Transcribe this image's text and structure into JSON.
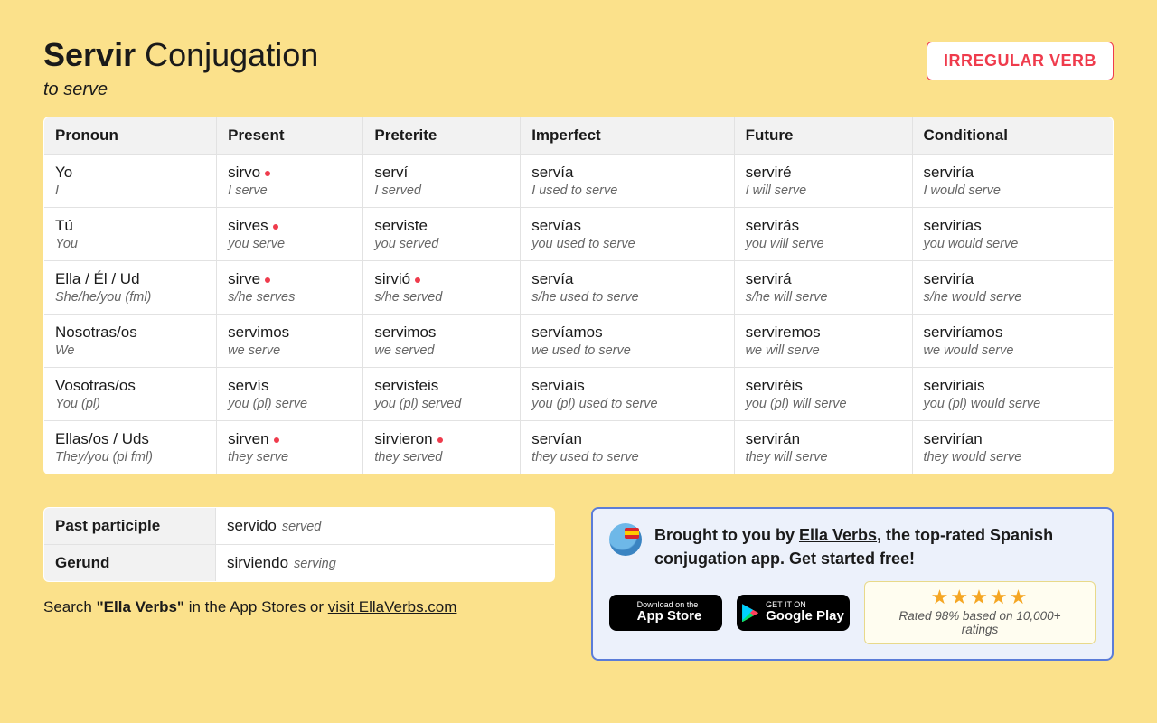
{
  "title_verb": "Servir",
  "title_rest": "Conjugation",
  "translation": "to serve",
  "badge": "IRREGULAR VERB",
  "headers": [
    "Pronoun",
    "Present",
    "Preterite",
    "Imperfect",
    "Future",
    "Conditional"
  ],
  "rows": [
    {
      "pronoun_es": "Yo",
      "pronoun_en": "I",
      "cells": [
        {
          "es": "sirvo",
          "en": "I serve",
          "dot": true
        },
        {
          "es": "serví",
          "en": "I served",
          "dot": false
        },
        {
          "es": "servía",
          "en": "I used to serve",
          "dot": false
        },
        {
          "es": "serviré",
          "en": "I will serve",
          "dot": false
        },
        {
          "es": "serviría",
          "en": "I would serve",
          "dot": false
        }
      ]
    },
    {
      "pronoun_es": "Tú",
      "pronoun_en": "You",
      "cells": [
        {
          "es": "sirves",
          "en": "you serve",
          "dot": true
        },
        {
          "es": "serviste",
          "en": "you served",
          "dot": false
        },
        {
          "es": "servías",
          "en": "you used to serve",
          "dot": false
        },
        {
          "es": "servirás",
          "en": "you will serve",
          "dot": false
        },
        {
          "es": "servirías",
          "en": "you would serve",
          "dot": false
        }
      ]
    },
    {
      "pronoun_es": "Ella / Él / Ud",
      "pronoun_en": "She/he/you (fml)",
      "cells": [
        {
          "es": "sirve",
          "en": "s/he serves",
          "dot": true
        },
        {
          "es": "sirvió",
          "en": "s/he served",
          "dot": true
        },
        {
          "es": "servía",
          "en": "s/he used to serve",
          "dot": false
        },
        {
          "es": "servirá",
          "en": "s/he will serve",
          "dot": false
        },
        {
          "es": "serviría",
          "en": "s/he would serve",
          "dot": false
        }
      ]
    },
    {
      "pronoun_es": "Nosotras/os",
      "pronoun_en": "We",
      "cells": [
        {
          "es": "servimos",
          "en": "we serve",
          "dot": false
        },
        {
          "es": "servimos",
          "en": "we served",
          "dot": false
        },
        {
          "es": "servíamos",
          "en": "we used to serve",
          "dot": false
        },
        {
          "es": "serviremos",
          "en": "we will serve",
          "dot": false
        },
        {
          "es": "serviríamos",
          "en": "we would serve",
          "dot": false
        }
      ]
    },
    {
      "pronoun_es": "Vosotras/os",
      "pronoun_en": "You (pl)",
      "cells": [
        {
          "es": "servís",
          "en": "you (pl) serve",
          "dot": false
        },
        {
          "es": "servisteis",
          "en": "you (pl) served",
          "dot": false
        },
        {
          "es": "servíais",
          "en": "you (pl) used to serve",
          "dot": false
        },
        {
          "es": "serviréis",
          "en": "you (pl) will serve",
          "dot": false
        },
        {
          "es": "serviríais",
          "en": "you (pl) would serve",
          "dot": false
        }
      ]
    },
    {
      "pronoun_es": "Ellas/os / Uds",
      "pronoun_en": "They/you (pl fml)",
      "cells": [
        {
          "es": "sirven",
          "en": "they serve",
          "dot": true
        },
        {
          "es": "sirvieron",
          "en": "they served",
          "dot": true
        },
        {
          "es": "servían",
          "en": "they used to serve",
          "dot": false
        },
        {
          "es": "servirán",
          "en": "they will serve",
          "dot": false
        },
        {
          "es": "servirían",
          "en": "they would serve",
          "dot": false
        }
      ]
    }
  ],
  "forms": [
    {
      "label": "Past participle",
      "es": "servido",
      "en": "served"
    },
    {
      "label": "Gerund",
      "es": "sirviendo",
      "en": "serving"
    }
  ],
  "search_prefix": "Search ",
  "search_quote": "\"Ella Verbs\"",
  "search_mid": " in the App Stores or ",
  "search_link": "visit EllaVerbs.com",
  "promo_pre": "Brought to you by ",
  "promo_link": "Ella Verbs",
  "promo_post": ", the top-rated Spanish conjugation app. Get started free!",
  "appstore_small": "Download on the",
  "appstore_big": "App Store",
  "play_small": "GET IT ON",
  "play_big": "Google Play",
  "rating_text": "Rated 98% based on 10,000+ ratings"
}
